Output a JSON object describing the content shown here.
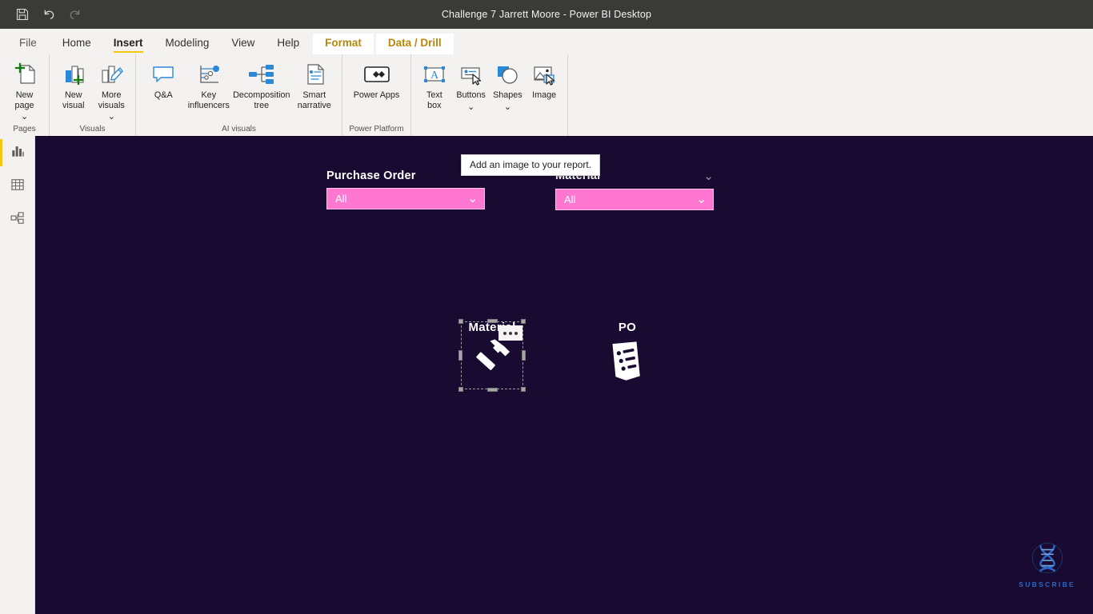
{
  "window": {
    "title": "Challenge 7 Jarrett Moore - Power BI Desktop",
    "quick_access": [
      {
        "name": "save-icon",
        "label": "Save",
        "enabled": true
      },
      {
        "name": "undo-icon",
        "label": "Undo",
        "enabled": true
      },
      {
        "name": "redo-icon",
        "label": "Redo",
        "enabled": false
      }
    ]
  },
  "ribbon": {
    "tabs": [
      {
        "label": "File",
        "state": "file"
      },
      {
        "label": "Home",
        "state": "normal"
      },
      {
        "label": "Insert",
        "state": "active"
      },
      {
        "label": "Modeling",
        "state": "normal"
      },
      {
        "label": "View",
        "state": "normal"
      },
      {
        "label": "Help",
        "state": "normal"
      },
      {
        "label": "Format",
        "state": "contextual"
      },
      {
        "label": "Data / Drill",
        "state": "contextual"
      }
    ],
    "groups": [
      {
        "label": "Pages",
        "items": [
          {
            "name": "new-page-button",
            "label": "New\npage",
            "icon": "new-page-icon",
            "dropdown": true
          }
        ]
      },
      {
        "label": "Visuals",
        "items": [
          {
            "name": "new-visual-button",
            "label": "New\nvisual",
            "icon": "new-visual-icon",
            "dropdown": false
          },
          {
            "name": "more-visuals-button",
            "label": "More\nvisuals",
            "icon": "more-visuals-icon",
            "dropdown": true
          }
        ]
      },
      {
        "label": "AI visuals",
        "items": [
          {
            "name": "qna-button",
            "label": "Q&A",
            "icon": "qna-icon",
            "dropdown": false
          },
          {
            "name": "key-influencers-button",
            "label": "Key\ninfluencers",
            "icon": "key-influencers-icon",
            "dropdown": false
          },
          {
            "name": "decomposition-tree-button",
            "label": "Decomposition\ntree",
            "icon": "decomposition-tree-icon",
            "dropdown": false
          },
          {
            "name": "smart-narrative-button",
            "label": "Smart\nnarrative",
            "icon": "smart-narrative-icon",
            "dropdown": false
          }
        ]
      },
      {
        "label": "Power Platform",
        "items": [
          {
            "name": "power-apps-button",
            "label": "Power Apps",
            "icon": "power-apps-icon",
            "dropdown": false
          }
        ]
      },
      {
        "label": "",
        "items": [
          {
            "name": "text-box-button",
            "label": "Text\nbox",
            "icon": "text-box-icon",
            "dropdown": false
          },
          {
            "name": "buttons-button",
            "label": "Buttons",
            "icon": "buttons-icon",
            "dropdown": true
          },
          {
            "name": "shapes-button",
            "label": "Shapes",
            "icon": "shapes-icon",
            "dropdown": true
          },
          {
            "name": "image-button",
            "label": "Image",
            "icon": "image-icon",
            "dropdown": false
          }
        ]
      }
    ],
    "tooltip": "Add an image to your report."
  },
  "view_rail": [
    {
      "name": "sidebar-item-report-view",
      "label": "Report view",
      "icon": "report-view-icon",
      "active": true
    },
    {
      "name": "sidebar-item-data-view",
      "label": "Data view",
      "icon": "data-view-icon",
      "active": false
    },
    {
      "name": "sidebar-item-model-view",
      "label": "Model view",
      "icon": "model-view-icon",
      "active": false
    }
  ],
  "canvas": {
    "background_color": "#180a30",
    "slicers": [
      {
        "name": "slicer-purchase-order",
        "title": "Purchase Order",
        "value": "All",
        "header_chevron": false,
        "accent_color": "#ff77d1"
      },
      {
        "name": "slicer-material",
        "title": "Material",
        "value": "All",
        "header_chevron": true,
        "accent_color": "#ff77d1"
      }
    ],
    "images": [
      {
        "name": "image-material",
        "caption": "Material",
        "icon": "hammer-icon",
        "selected": true,
        "more_options": "..."
      },
      {
        "name": "image-po",
        "caption": "PO",
        "icon": "invoice-document-icon",
        "selected": false,
        "more_options": ""
      }
    ]
  },
  "watermark": {
    "name": "subscribe-watermark",
    "label": "SUBSCRIBE",
    "icon": "dna-helix-icon",
    "color": "#2f6fd0"
  }
}
